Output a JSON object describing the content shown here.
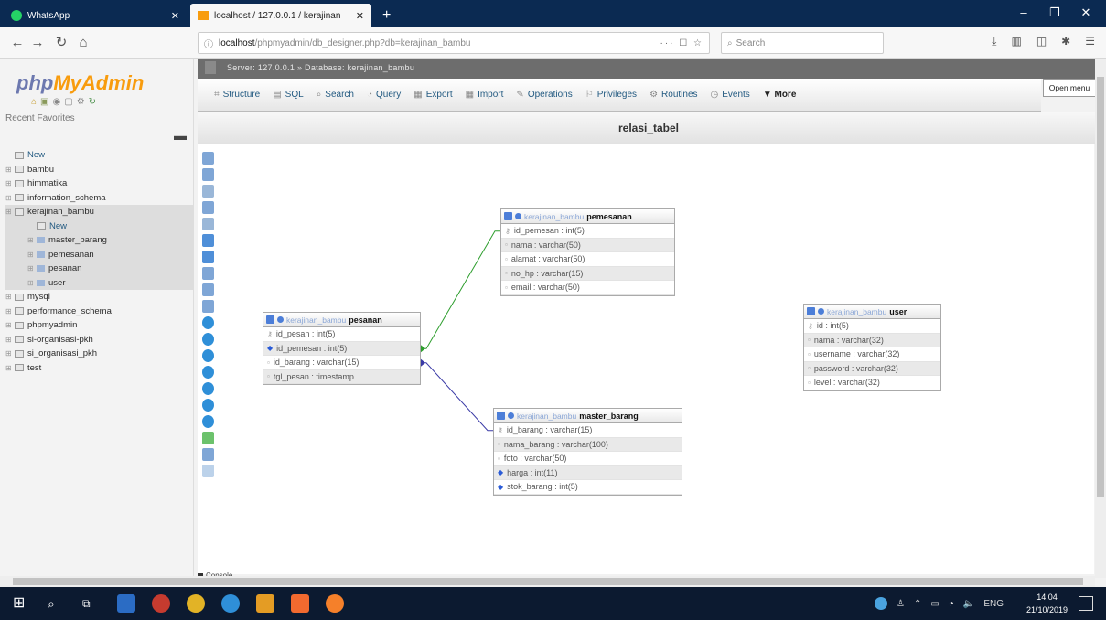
{
  "browser": {
    "tabs": [
      {
        "label": "WhatsApp",
        "active": false
      },
      {
        "label": "localhost / 127.0.0.1 / kerajinan",
        "active": true
      }
    ],
    "url_host": "localhost",
    "url_path": "/phpmyadmin/db_designer.php?db=kerajinan_bambu",
    "url_actions": "··· ☐ ☆",
    "search_placeholder": "Search"
  },
  "sidebar": {
    "logo_php": "php",
    "logo_myadmin": "MyAdmin",
    "recent_favorites": "Recent  Favorites",
    "tree": [
      {
        "label": "New",
        "level": 0,
        "type": "new"
      },
      {
        "label": "bambu",
        "level": 0,
        "type": "db"
      },
      {
        "label": "himmatika",
        "level": 0,
        "type": "db"
      },
      {
        "label": "information_schema",
        "level": 0,
        "type": "db"
      },
      {
        "label": "kerajinan_bambu",
        "level": 0,
        "type": "db",
        "selected": true
      },
      {
        "label": "New",
        "level": 1,
        "type": "new",
        "selected": true
      },
      {
        "label": "master_barang",
        "level": 1,
        "type": "table",
        "selected": true
      },
      {
        "label": "pemesanan",
        "level": 1,
        "type": "table",
        "selected": true
      },
      {
        "label": "pesanan",
        "level": 1,
        "type": "table",
        "selected": true
      },
      {
        "label": "user",
        "level": 1,
        "type": "table",
        "selected": true
      },
      {
        "label": "mysql",
        "level": 0,
        "type": "db"
      },
      {
        "label": "performance_schema",
        "level": 0,
        "type": "db"
      },
      {
        "label": "phpmyadmin",
        "level": 0,
        "type": "db"
      },
      {
        "label": "si-organisasi-pkh",
        "level": 0,
        "type": "db"
      },
      {
        "label": "si_organisasi_pkh",
        "level": 0,
        "type": "db"
      },
      {
        "label": "test",
        "level": 0,
        "type": "db"
      }
    ]
  },
  "topnav": {
    "breadcrumb": "Server: 127.0.0.1 » Database: kerajinan_bambu"
  },
  "menu": {
    "items": [
      {
        "label": "Structure",
        "icon": "structure-icon",
        "glyph": "⌗"
      },
      {
        "label": "SQL",
        "icon": "sql-icon",
        "glyph": "▤"
      },
      {
        "label": "Search",
        "icon": "search-icon",
        "glyph": "⌕"
      },
      {
        "label": "Query",
        "icon": "query-icon",
        "glyph": "◔"
      },
      {
        "label": "Export",
        "icon": "export-icon",
        "glyph": "▦"
      },
      {
        "label": "Import",
        "icon": "import-icon",
        "glyph": "▦"
      },
      {
        "label": "Operations",
        "icon": "operations-icon",
        "glyph": "✎"
      },
      {
        "label": "Privileges",
        "icon": "privileges-icon",
        "glyph": "⚐"
      },
      {
        "label": "Routines",
        "icon": "routines-icon",
        "glyph": "⚙"
      },
      {
        "label": "Events",
        "icon": "events-icon",
        "glyph": "◷"
      }
    ],
    "more": "▼ More",
    "open_menu": "Open menu"
  },
  "designer": {
    "title": "relasi_tabel",
    "console": "Console",
    "db_prefix": "kerajinan_bambu",
    "tables": [
      {
        "name": "pemesanan",
        "columns": [
          {
            "name": "id_pemesan : int(5)",
            "key": "primary"
          },
          {
            "name": "nama : varchar(50)",
            "key": "none"
          },
          {
            "name": "alamat : varchar(50)",
            "key": "none"
          },
          {
            "name": "no_hp : varchar(15)",
            "key": "none"
          },
          {
            "name": "email : varchar(50)",
            "key": "none"
          }
        ]
      },
      {
        "name": "pesanan",
        "columns": [
          {
            "name": "id_pesan : int(5)",
            "key": "primary"
          },
          {
            "name": "id_pemesan : int(5)",
            "key": "index"
          },
          {
            "name": "id_barang : varchar(15)",
            "key": "none"
          },
          {
            "name": "tgl_pesan : timestamp",
            "key": "none"
          }
        ]
      },
      {
        "name": "user",
        "columns": [
          {
            "name": "id : int(5)",
            "key": "primary"
          },
          {
            "name": "nama : varchar(32)",
            "key": "none"
          },
          {
            "name": "username : varchar(32)",
            "key": "none"
          },
          {
            "name": "password : varchar(32)",
            "key": "none"
          },
          {
            "name": "level : varchar(32)",
            "key": "none"
          }
        ]
      },
      {
        "name": "master_barang",
        "columns": [
          {
            "name": "id_barang : varchar(15)",
            "key": "primary"
          },
          {
            "name": "nama_barang : varchar(100)",
            "key": "none"
          },
          {
            "name": "foto : varchar(50)",
            "key": "none"
          },
          {
            "name": "harga : int(11)",
            "key": "index"
          },
          {
            "name": "stok_barang : int(5)",
            "key": "index"
          }
        ]
      }
    ],
    "relations": [
      {
        "from": "pesanan.id_pemesan",
        "to": "pemesanan.id_pemesan",
        "color": "#2e9e2e"
      },
      {
        "from": "pesanan.id_barang",
        "to": "master_barang.id_barang",
        "color": "#3a3aa6"
      }
    ]
  },
  "taskbar": {
    "time": "14:04",
    "date": "21/10/2019",
    "lang": "ENG"
  }
}
